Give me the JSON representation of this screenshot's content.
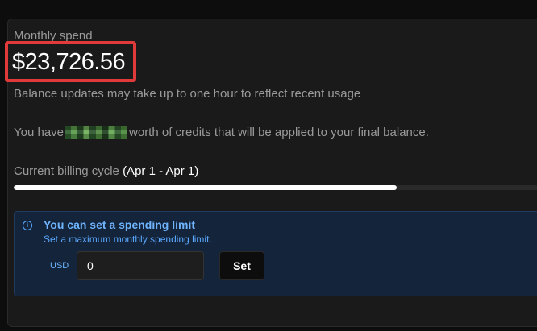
{
  "summary": {
    "label": "Monthly spend",
    "amount": "$23,726.56",
    "note": "Balance updates may take up to one hour to reflect recent usage"
  },
  "credits": {
    "prefix": "You have",
    "suffix": "worth of credits that will be applied to your final balance."
  },
  "billing": {
    "label": "Current billing cycle",
    "range": "(Apr 1 - Apr 1)",
    "progress": 0.73
  },
  "limit": {
    "title": "You can set a spending limit",
    "subtitle": "Set a maximum monthly spending limit.",
    "currency": "USD",
    "value": "0",
    "button": "Set"
  },
  "colors": {
    "highlight": "#e03a3a",
    "info_accent": "#6fb4ff"
  }
}
